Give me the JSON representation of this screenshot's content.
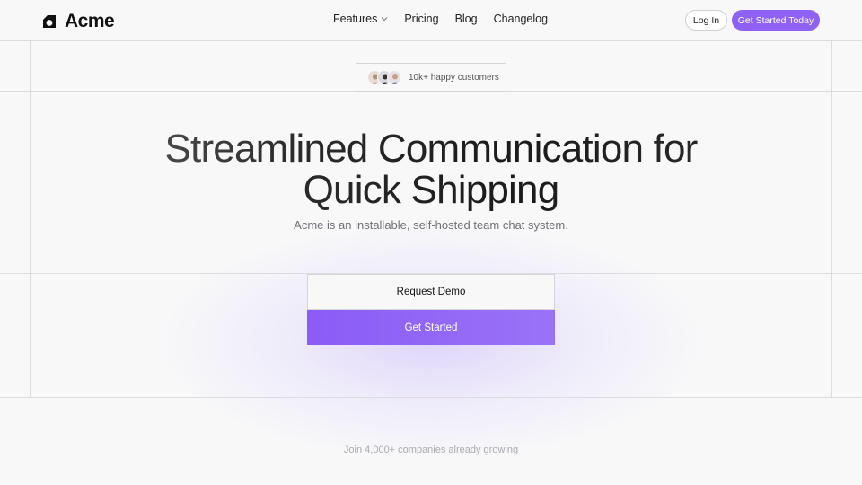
{
  "brand": {
    "name": "Acme"
  },
  "nav": {
    "items": [
      {
        "label": "Features",
        "has_dropdown": true
      },
      {
        "label": "Pricing"
      },
      {
        "label": "Blog"
      },
      {
        "label": "Changelog"
      }
    ]
  },
  "header": {
    "login_label": "Log In",
    "cta_label": "Get Started Today"
  },
  "social_proof": {
    "text": "10k+ happy customers"
  },
  "hero": {
    "title_line1": "Streamlined Communication for",
    "title_line2": "Quick Shipping",
    "subtitle": "Acme is an installable, self-hosted team chat system.",
    "demo_label": "Request Demo",
    "start_label": "Get Started"
  },
  "footer_note": {
    "text": "Join 4,000+ companies already growing"
  },
  "colors": {
    "accent": "#8f62f5",
    "background": "#f8f8f9",
    "grid_line": "#dcdce0"
  },
  "icons": [
    "acme-logo-icon",
    "chevron-down-icon",
    "avatar-icon"
  ]
}
